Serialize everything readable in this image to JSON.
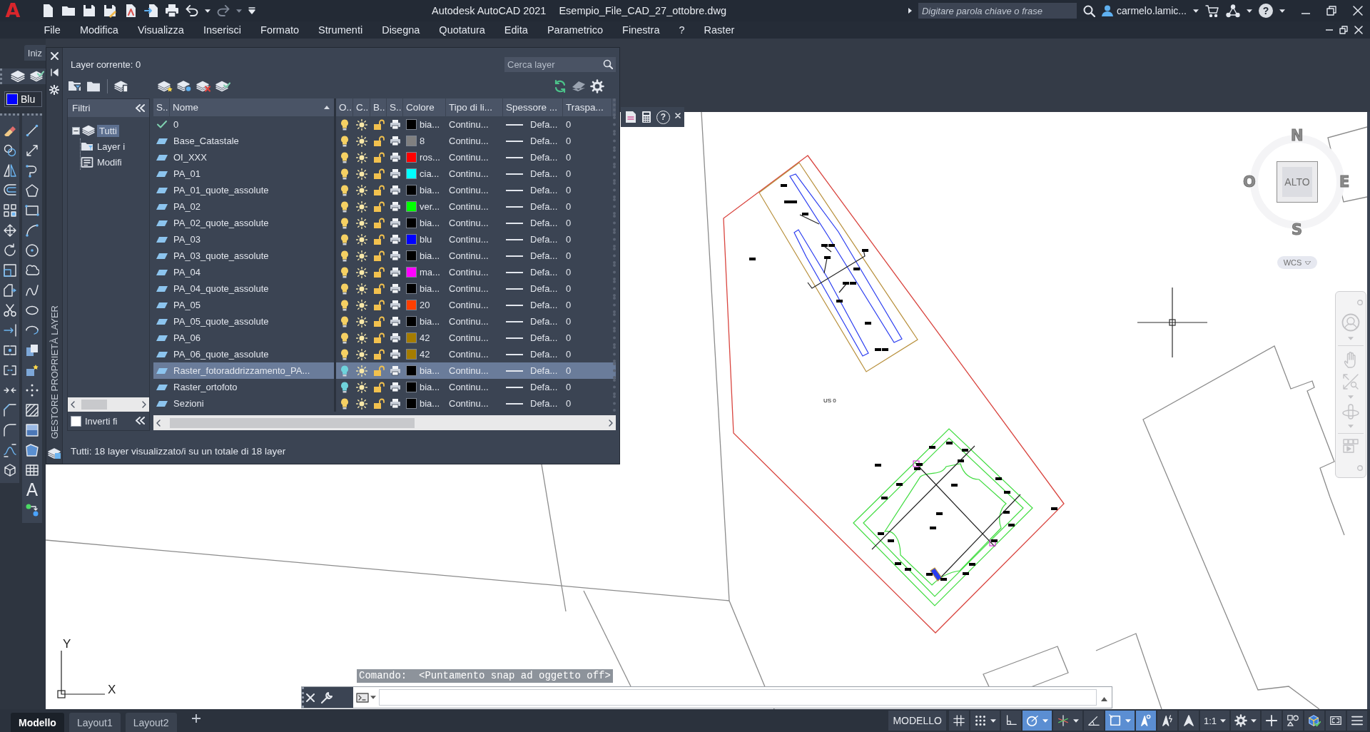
{
  "title_bar": {
    "app_logo": "A",
    "app_title": "Autodesk AutoCAD 2021",
    "file_name": "Esempio_File_CAD_27_ottobre.dwg",
    "search": {
      "placeholder": "Digitare parola chiave o frase"
    },
    "user": "carmelo.lamic...",
    "help_glyph": "?"
  },
  "menu_bar": {
    "items": [
      "File",
      "Modifica",
      "Visualizza",
      "Inserisci",
      "Formato",
      "Strumenti",
      "Disegna",
      "Quotatura",
      "Edita",
      "Parametrico",
      "Finestra",
      "?",
      "Raster"
    ]
  },
  "file_tabs": [
    {
      "label": "Iniz"
    }
  ],
  "color_control": {
    "label": "Blu"
  },
  "draw_toolbar": {
    "text_glyph": "A"
  },
  "layer_palette": {
    "title": "GESTORE PROPRIETÀ LAYER",
    "current_layer": "Layer corrente: 0",
    "search": {
      "placeholder": "Cerca layer"
    },
    "filters": {
      "header": "Filtri",
      "tree": [
        {
          "label": "Tutti",
          "kind": "all",
          "selected": true,
          "expanded": true,
          "children": [
            {
              "label": "Layer i",
              "kind": "group",
              "selected": false
            },
            {
              "label": "Modifi",
              "kind": "property",
              "selected": false
            }
          ]
        }
      ],
      "invert": {
        "label": "Inverti fi",
        "checked": false
      }
    },
    "columns": [
      "S..",
      "Nome",
      "O..",
      "C..",
      "B..",
      "S..",
      "Colore",
      "Tipo di li...",
      "Spessore ...",
      "Traspa..."
    ],
    "rows": [
      {
        "current": true,
        "name": "0",
        "on": true,
        "frozen": false,
        "locked": false,
        "plot": true,
        "color": "#000000",
        "color_name": "bia...",
        "linetype": "Continu...",
        "lineweight": "Defa...",
        "transparency": "0",
        "selected": false
      },
      {
        "current": false,
        "name": "Base_Catastale",
        "on": true,
        "frozen": false,
        "locked": false,
        "plot": true,
        "color": "#808080",
        "color_name": "8",
        "linetype": "Continu...",
        "lineweight": "Defa...",
        "transparency": "0",
        "selected": false
      },
      {
        "current": false,
        "name": "OI_XXX",
        "on": true,
        "frozen": false,
        "locked": false,
        "plot": true,
        "color": "#ff0000",
        "color_name": "ros...",
        "linetype": "Continu...",
        "lineweight": "Defa...",
        "transparency": "0",
        "selected": false
      },
      {
        "current": false,
        "name": "PA_01",
        "on": true,
        "frozen": false,
        "locked": false,
        "plot": true,
        "color": "#00ffff",
        "color_name": "cia...",
        "linetype": "Continu...",
        "lineweight": "Defa...",
        "transparency": "0",
        "selected": false
      },
      {
        "current": false,
        "name": "PA_01_quote_assolute",
        "on": true,
        "frozen": false,
        "locked": false,
        "plot": true,
        "color": "#000000",
        "color_name": "bia...",
        "linetype": "Continu...",
        "lineweight": "Defa...",
        "transparency": "0",
        "selected": false
      },
      {
        "current": false,
        "name": "PA_02",
        "on": true,
        "frozen": false,
        "locked": false,
        "plot": true,
        "color": "#00ff00",
        "color_name": "ver...",
        "linetype": "Continu...",
        "lineweight": "Defa...",
        "transparency": "0",
        "selected": false
      },
      {
        "current": false,
        "name": "PA_02_quote_assolute",
        "on": true,
        "frozen": false,
        "locked": false,
        "plot": true,
        "color": "#000000",
        "color_name": "bia...",
        "linetype": "Continu...",
        "lineweight": "Defa...",
        "transparency": "0",
        "selected": false
      },
      {
        "current": false,
        "name": "PA_03",
        "on": true,
        "frozen": false,
        "locked": false,
        "plot": true,
        "color": "#0000ff",
        "color_name": "blu",
        "linetype": "Continu...",
        "lineweight": "Defa...",
        "transparency": "0",
        "selected": false
      },
      {
        "current": false,
        "name": "PA_03_quote_assolute",
        "on": true,
        "frozen": false,
        "locked": false,
        "plot": true,
        "color": "#000000",
        "color_name": "bia...",
        "linetype": "Continu...",
        "lineweight": "Defa...",
        "transparency": "0",
        "selected": false
      },
      {
        "current": false,
        "name": "PA_04",
        "on": true,
        "frozen": false,
        "locked": false,
        "plot": true,
        "color": "#ff00ff",
        "color_name": "ma...",
        "linetype": "Continu...",
        "lineweight": "Defa...",
        "transparency": "0",
        "selected": false
      },
      {
        "current": false,
        "name": "PA_04_quote_assolute",
        "on": true,
        "frozen": false,
        "locked": false,
        "plot": true,
        "color": "#000000",
        "color_name": "bia...",
        "linetype": "Continu...",
        "lineweight": "Defa...",
        "transparency": "0",
        "selected": false
      },
      {
        "current": false,
        "name": "PA_05",
        "on": true,
        "frozen": false,
        "locked": false,
        "plot": true,
        "color": "#ff3f00",
        "color_name": "20",
        "linetype": "Continu...",
        "lineweight": "Defa...",
        "transparency": "0",
        "selected": false
      },
      {
        "current": false,
        "name": "PA_05_quote_assolute",
        "on": true,
        "frozen": false,
        "locked": false,
        "plot": true,
        "color": "#000000",
        "color_name": "bia...",
        "linetype": "Continu...",
        "lineweight": "Defa...",
        "transparency": "0",
        "selected": false
      },
      {
        "current": false,
        "name": "PA_06",
        "on": true,
        "frozen": false,
        "locked": false,
        "plot": true,
        "color": "#a57c00",
        "color_name": "42",
        "linetype": "Continu...",
        "lineweight": "Defa...",
        "transparency": "0",
        "selected": false
      },
      {
        "current": false,
        "name": "PA_06_quote_assolute",
        "on": true,
        "frozen": false,
        "locked": false,
        "plot": true,
        "color": "#a57c00",
        "color_name": "42",
        "linetype": "Continu...",
        "lineweight": "Defa...",
        "transparency": "0",
        "selected": false
      },
      {
        "current": false,
        "name": "Raster_fotoraddrizzamento_PA...",
        "on": false,
        "frozen": false,
        "locked": false,
        "plot": true,
        "color": "#000000",
        "color_name": "bia...",
        "linetype": "Continu...",
        "lineweight": "Defa...",
        "transparency": "0",
        "selected": true
      },
      {
        "current": false,
        "name": "Raster_ortofoto",
        "on": false,
        "frozen": false,
        "locked": false,
        "plot": true,
        "color": "#000000",
        "color_name": "bia...",
        "linetype": "Continu...",
        "lineweight": "Defa...",
        "transparency": "0",
        "selected": false
      },
      {
        "current": false,
        "name": "Sezioni",
        "on": true,
        "frozen": false,
        "locked": false,
        "plot": true,
        "color": "#000000",
        "color_name": "bia...",
        "linetype": "Continu...",
        "lineweight": "Defa...",
        "transparency": "0",
        "selected": false
      }
    ],
    "status": "Tutti: 18 layer visualizzato/i su un totale di 18 layer"
  },
  "floating_toolbar": {
    "help_glyph": "?"
  },
  "drawing": {
    "label": "US 0",
    "viewcube": {
      "north": "N",
      "west": "O",
      "east": "E",
      "south": "S",
      "face": "ALTO",
      "ucs": "WCS"
    },
    "ucs_icon": {
      "y_label": "Y",
      "x_label": "X"
    }
  },
  "command_line": {
    "history": "Comando:  <Puntamento snap ad oggetto off>"
  },
  "layout_tabs": [
    {
      "label": "Modello",
      "selected": true
    },
    {
      "label": "Layout1",
      "selected": false
    },
    {
      "label": "Layout2",
      "selected": false
    }
  ],
  "status_bar": {
    "space": "MODELLO",
    "tools": [
      {
        "kind": "grid",
        "on": false
      },
      {
        "kind": "snap",
        "on": false,
        "dropdown": true
      },
      {
        "kind": "ortho",
        "on": false
      },
      {
        "kind": "polar",
        "on": true,
        "dropdown": true
      },
      {
        "kind": "isodraft",
        "on": false,
        "dropdown": true
      },
      {
        "kind": "otrack",
        "on": false
      },
      {
        "kind": "osnap",
        "on": true,
        "dropdown": true
      },
      {
        "kind": "annovis",
        "on": true
      },
      {
        "kind": "autoscale",
        "on": false
      },
      {
        "kind": "annoscale"
      },
      {
        "kind": "scale",
        "label": "1:1",
        "dropdown": true
      },
      {
        "kind": "workspace",
        "dropdown": true
      },
      {
        "kind": "annomonitor"
      },
      {
        "kind": "isolate"
      },
      {
        "kind": "hardware"
      },
      {
        "kind": "cleanscreen"
      },
      {
        "kind": "customize"
      }
    ]
  }
}
